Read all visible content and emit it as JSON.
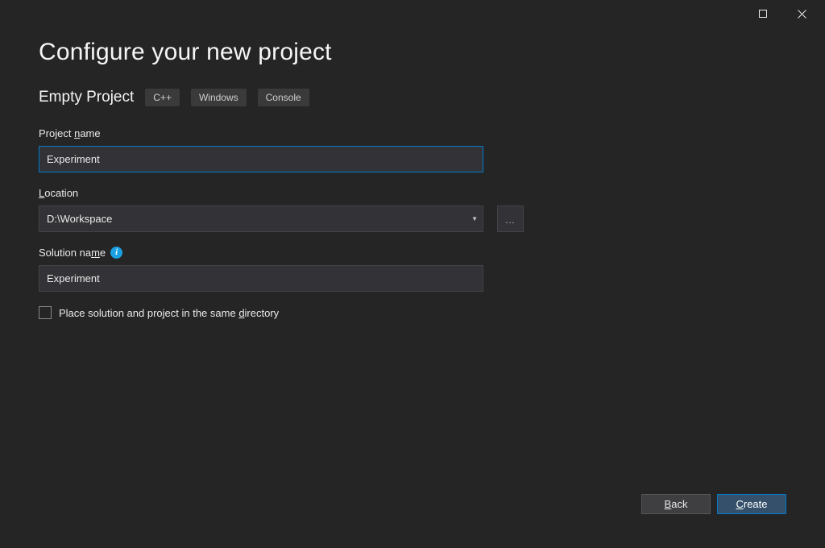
{
  "header": {
    "title": "Configure your new project"
  },
  "template": {
    "name": "Empty Project",
    "tags": [
      "C++",
      "Windows",
      "Console"
    ]
  },
  "fields": {
    "projectName": {
      "label_pre": "Project ",
      "label_u": "n",
      "label_post": "ame",
      "value": "Experiment"
    },
    "location": {
      "label_u": "L",
      "label_post": "ocation",
      "value": "D:\\Workspace"
    },
    "solutionName": {
      "label_pre": "Solution na",
      "label_u": "m",
      "label_post": "e",
      "value": "Experiment"
    },
    "sameDir": {
      "label_pre": "Place solution and project in the same ",
      "label_u": "d",
      "label_post": "irectory",
      "checked": false
    }
  },
  "icons": {
    "browse": "..."
  },
  "footer": {
    "back_u": "B",
    "back_post": "ack",
    "create_u": "C",
    "create_post": "reate"
  },
  "colors": {
    "accent": "#007acc",
    "bg": "#252526",
    "inputBg": "#333337"
  }
}
